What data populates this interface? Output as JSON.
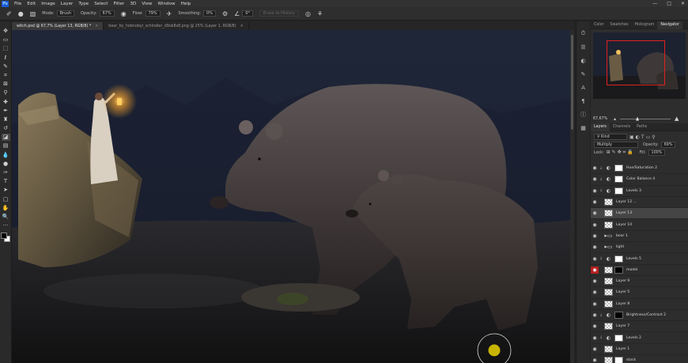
{
  "menubar": {
    "logo": "Ps",
    "items": [
      "File",
      "Edit",
      "Image",
      "Layer",
      "Type",
      "Select",
      "Filter",
      "3D",
      "View",
      "Window",
      "Help"
    ],
    "window_controls": [
      "—",
      "□",
      "✕"
    ]
  },
  "options": {
    "mode_label": "Mode:",
    "mode_value": "Brush",
    "opacity_label": "Opacity:",
    "opacity_value": "67%",
    "flow_label": "Flow:",
    "flow_value": "79%",
    "smoothing_label": "Smoothing:",
    "smoothing_value": "0%",
    "angle_value": "0°",
    "erase_history_label": "Erase to History"
  },
  "tabs": [
    {
      "label": "witch.psd @ 67,7% (Layer 13, RGB/8) *",
      "active": true
    },
    {
      "label": "bear_by_hobnobyl_schindler_d9ok8s8.png @ 25% (Layer 1, RGB/8)",
      "active": false
    }
  ],
  "tools": [
    "move",
    "artboard",
    "marquee",
    "lasso",
    "quick-select",
    "crop",
    "frame",
    "eyedropper",
    "healing",
    "brush",
    "stamp",
    "history-brush",
    "eraser",
    "gradient",
    "blur",
    "dodge",
    "pen",
    "type",
    "path-select",
    "shape",
    "hand",
    "zoom",
    "more"
  ],
  "nav_panel": {
    "tabs": [
      "Color",
      "Swatches",
      "Histogram",
      "Navigator"
    ],
    "active_tab": "Navigator",
    "zoom": "67,67%"
  },
  "layers_panel": {
    "tabs": [
      "Layers",
      "Channels",
      "Paths"
    ],
    "active_tab": "Layers",
    "filter_kind": "Kind",
    "blend_mode": "Multiply",
    "opacity_label": "Opacity:",
    "opacity_value": "69%",
    "lock_label": "Lock:",
    "fill_label": "Fill:",
    "fill_value": "100%",
    "layers": [
      {
        "name": "Hue/Saturation 2",
        "thumb": "adj",
        "mask": "white",
        "clip": true,
        "selected": false,
        "eye": "on"
      },
      {
        "name": "Color Balance 4",
        "thumb": "adj",
        "mask": "white",
        "clip": true,
        "selected": false,
        "eye": "on"
      },
      {
        "name": "Levels 3",
        "thumb": "adj",
        "mask": "white",
        "clip": true,
        "selected": false,
        "eye": "on"
      },
      {
        "name": "Layer 12 ...",
        "thumb": "check",
        "mask": "",
        "clip": false,
        "selected": false,
        "eye": "on"
      },
      {
        "name": "Layer 13",
        "thumb": "check",
        "mask": "",
        "clip": false,
        "selected": true,
        "eye": "on"
      },
      {
        "name": "Layer 10",
        "thumb": "check",
        "mask": "",
        "clip": false,
        "selected": false,
        "eye": "on"
      },
      {
        "name": "bear 1",
        "thumb": "folder",
        "mask": "",
        "clip": false,
        "selected": false,
        "eye": "on"
      },
      {
        "name": "light",
        "thumb": "folder",
        "mask": "",
        "clip": false,
        "selected": false,
        "eye": "on"
      },
      {
        "name": "Levels 5",
        "thumb": "adj",
        "mask": "white",
        "clip": true,
        "selected": false,
        "eye": "on"
      },
      {
        "name": "model",
        "thumb": "check",
        "mask": "black",
        "clip": false,
        "selected": false,
        "eye": "red"
      },
      {
        "name": "Layer 9",
        "thumb": "check",
        "mask": "",
        "clip": false,
        "selected": false,
        "eye": "on"
      },
      {
        "name": "Layer 5",
        "thumb": "check",
        "mask": "",
        "clip": false,
        "selected": false,
        "eye": "on"
      },
      {
        "name": "Layer 8",
        "thumb": "check",
        "mask": "",
        "clip": false,
        "selected": false,
        "eye": "on"
      },
      {
        "name": "Brightness/Contrast 2",
        "thumb": "adj",
        "mask": "black",
        "clip": true,
        "selected": false,
        "eye": "on"
      },
      {
        "name": "Layer 7",
        "thumb": "check",
        "mask": "",
        "clip": false,
        "selected": false,
        "eye": "on"
      },
      {
        "name": "Levels 2",
        "thumb": "adj",
        "mask": "white",
        "clip": true,
        "selected": false,
        "eye": "on"
      },
      {
        "name": "Layer 1",
        "thumb": "check",
        "mask": "",
        "clip": false,
        "selected": false,
        "eye": "on"
      },
      {
        "name": "stock",
        "thumb": "check",
        "mask": "white",
        "clip": false,
        "selected": false,
        "eye": "on"
      }
    ]
  },
  "colors": {
    "brush_cursor": "#c8b400",
    "selected_row": "#454545",
    "nav_box": "#e02020"
  }
}
